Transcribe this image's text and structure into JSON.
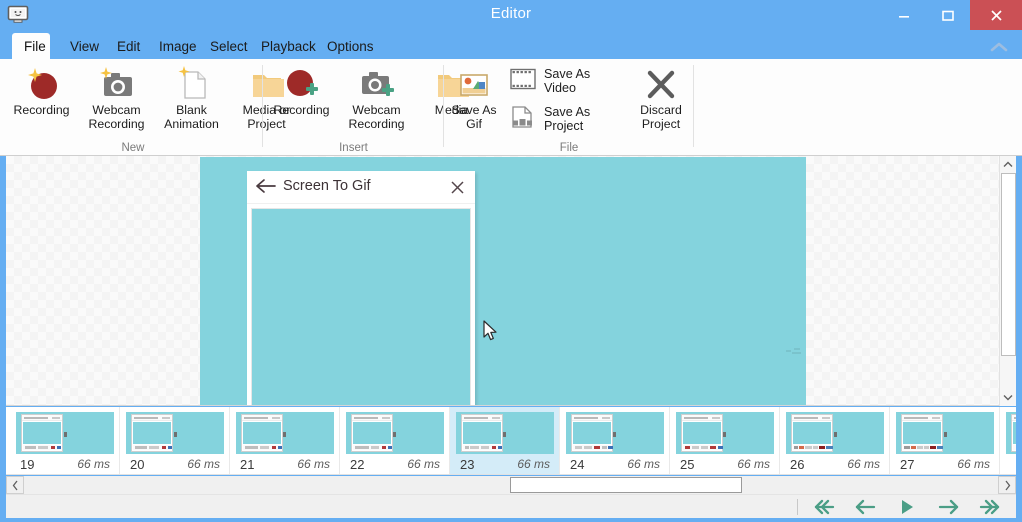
{
  "window": {
    "title": "Editor",
    "icon": "monitor-icon",
    "minimize_label": "Minimize",
    "maximize_label": "Maximize",
    "close_label": "Close",
    "accent_color": "#65aef2",
    "close_color": "#cb5055"
  },
  "ribbon": {
    "collapse_label": "Collapse Ribbon",
    "tabs": [
      {
        "label": "File",
        "active": true
      },
      {
        "label": "View",
        "active": false
      },
      {
        "label": "Edit",
        "active": false
      },
      {
        "label": "Image",
        "active": false
      },
      {
        "label": "Select",
        "active": false
      },
      {
        "label": "Playback",
        "active": false
      },
      {
        "label": "Options",
        "active": false
      }
    ],
    "groups": [
      {
        "label": "New",
        "items": [
          {
            "label": "Recording",
            "icon": "record-new-icon"
          },
          {
            "label": "Webcam Recording",
            "icon": "webcam-new-icon"
          },
          {
            "label": "Blank Animation",
            "icon": "blank-page-new-icon"
          },
          {
            "label": "Media or Project",
            "icon": "folder-icon"
          }
        ]
      },
      {
        "label": "Insert",
        "items": [
          {
            "label": "Recording",
            "icon": "record-add-icon"
          },
          {
            "label": "Webcam Recording",
            "icon": "webcam-add-icon"
          },
          {
            "label": "Media",
            "icon": "folder-icon"
          }
        ]
      },
      {
        "label": "File",
        "items": [
          {
            "label": "Save As Gif",
            "icon": "gif-image-icon"
          },
          {
            "label": "Save As Video",
            "icon": "film-icon"
          },
          {
            "label": "Save As Project",
            "icon": "project-file-icon"
          },
          {
            "label": "Discard Project",
            "icon": "x-cross-icon"
          }
        ]
      }
    ]
  },
  "canvas": {
    "background": "checkerboard",
    "frame_color": "#84d3dd",
    "dialog": {
      "title": "Screen To Gif",
      "back_label": "Back",
      "close_label": "Close"
    },
    "cursor": "mouse-pointer"
  },
  "scrollbars": {
    "vertical": {
      "up_label": "Scroll up",
      "down_label": "Scroll down"
    },
    "horizontal": {
      "left_label": "Scroll left",
      "right_label": "Scroll right"
    }
  },
  "filmstrip": {
    "selected_index": 23,
    "frames": [
      {
        "index": "19",
        "duration": "66 ms",
        "selected": false
      },
      {
        "index": "20",
        "duration": "66 ms",
        "selected": false
      },
      {
        "index": "21",
        "duration": "66 ms",
        "selected": false
      },
      {
        "index": "22",
        "duration": "66 ms",
        "selected": false
      },
      {
        "index": "23",
        "duration": "66 ms",
        "selected": true
      },
      {
        "index": "24",
        "duration": "66 ms",
        "selected": false
      },
      {
        "index": "25",
        "duration": "66 ms",
        "selected": false
      },
      {
        "index": "26",
        "duration": "66 ms",
        "selected": false
      },
      {
        "index": "27",
        "duration": "66 ms",
        "selected": false
      }
    ]
  },
  "playback": {
    "accent_color": "#4b9e86",
    "buttons": [
      {
        "name": "first-frame-button",
        "icon": "double-arrow-left-icon",
        "label": "First"
      },
      {
        "name": "previous-frame-button",
        "icon": "arrow-left-icon",
        "label": "Previous"
      },
      {
        "name": "play-button",
        "icon": "play-icon",
        "label": "Play"
      },
      {
        "name": "next-frame-button",
        "icon": "arrow-right-icon",
        "label": "Next"
      },
      {
        "name": "last-frame-button",
        "icon": "double-arrow-right-icon",
        "label": "Last"
      }
    ]
  }
}
